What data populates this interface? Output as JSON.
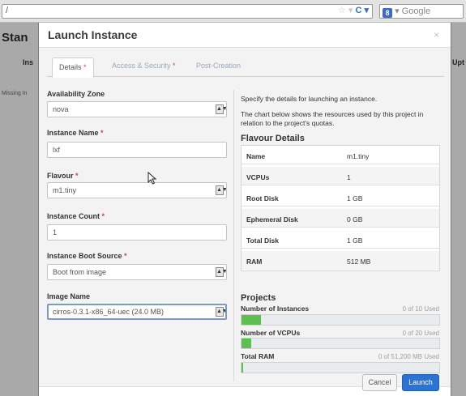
{
  "browser": {
    "url": "/",
    "search_badge": "8",
    "search_placeholder": "▾ Google",
    "url_icons": "☆ ▾",
    "refresh_icon": "C ▾"
  },
  "background": {
    "title": "Stan",
    "tab_left": "Ins",
    "tab_right": "Upt",
    "row_text": "Missing In"
  },
  "modal": {
    "title": "Launch Instance",
    "close": "×",
    "tabs": [
      {
        "label": "Details",
        "required": "*"
      },
      {
        "label": "Access & Security",
        "required": "*"
      },
      {
        "label": "Post-Creation",
        "required": ""
      }
    ]
  },
  "form": {
    "availability_zone": {
      "label": "Availability Zone",
      "value": "nova"
    },
    "instance_name": {
      "label": "Instance Name",
      "required": "*",
      "value": "lxf"
    },
    "flavour": {
      "label": "Flavour",
      "required": "*",
      "value": "m1.tiny"
    },
    "instance_count": {
      "label": "Instance Count",
      "required": "*",
      "value": "1"
    },
    "boot_source": {
      "label": "Instance Boot Source",
      "required": "*",
      "value": "Boot from image"
    },
    "image_name": {
      "label": "Image Name",
      "value": "cirros-0.3.1-x86_64-uec (24.0 MB)"
    }
  },
  "details": {
    "intro": "Specify the details for launching an instance.",
    "chart_note": "The chart below shows the resources used by this project in relation to the project's quotas.",
    "flavour_heading": "Flavour Details",
    "flavour_rows": [
      {
        "key": "Name",
        "value": "m1.tiny"
      },
      {
        "key": "VCPUs",
        "value": "1"
      },
      {
        "key": "Root Disk",
        "value": "1 GB"
      },
      {
        "key": "Ephemeral Disk",
        "value": "0 GB"
      },
      {
        "key": "Total Disk",
        "value": "1 GB"
      },
      {
        "key": "RAM",
        "value": "512 MB"
      }
    ],
    "projects_heading": "Projects",
    "quotas": [
      {
        "label": "Number of Instances",
        "used_text": "0 of 10 Used",
        "fill": 0.1
      },
      {
        "label": "Number of VCPUs",
        "used_text": "0 of 20 Used",
        "fill": 0.05
      },
      {
        "label": "Total RAM",
        "used_text": "0 of 51,200 MB Used",
        "fill": 0.01
      }
    ]
  },
  "footer": {
    "cancel": "Cancel",
    "launch": "Launch"
  },
  "colors": {
    "progress_fill": "#5cbf4f",
    "launch_button": "#2a73d4",
    "required_marker": "#c24b4b"
  }
}
